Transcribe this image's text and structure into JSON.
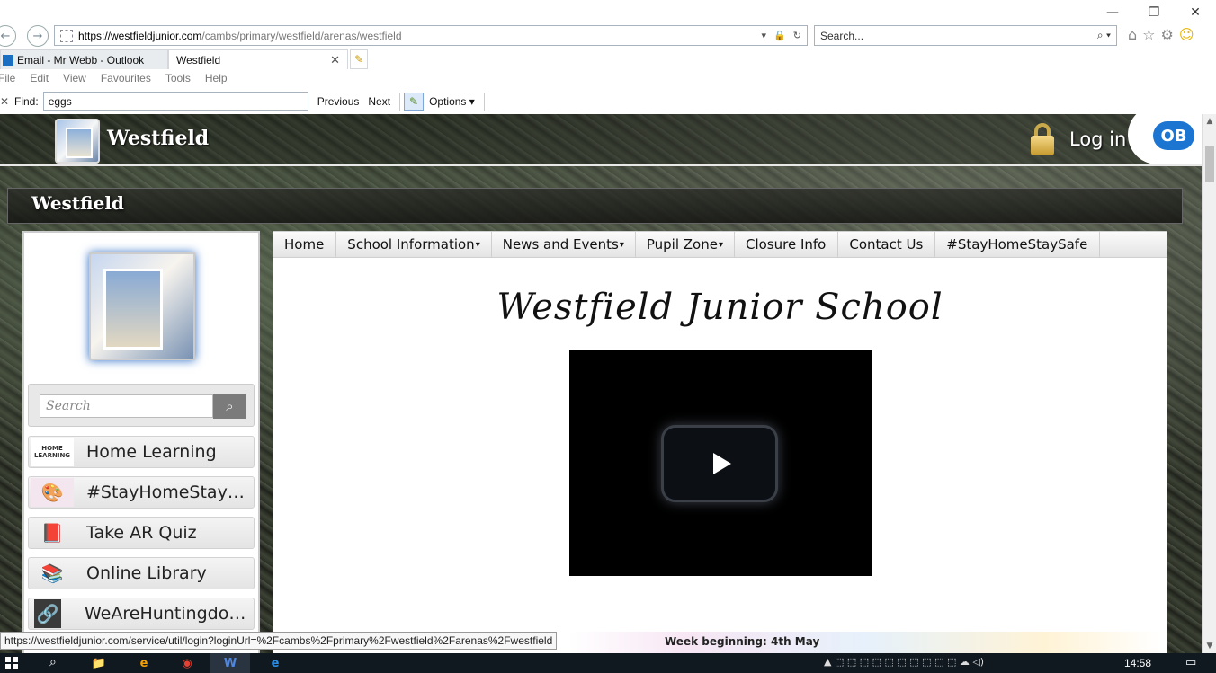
{
  "browser": {
    "window_controls": {
      "minimize": "—",
      "restore": "❐",
      "close": "✕"
    },
    "back_glyph": "←",
    "forward_glyph": "→",
    "address": {
      "host": "https://westfieldjunior.com",
      "path": "/cambs/primary/westfield/arenas/westfield"
    },
    "address_tools": {
      "dropdown": "▾",
      "lock": "🔒",
      "refresh": "↻"
    },
    "search_placeholder": "Search...",
    "search_tools": "⌕ ▾",
    "right_icons": {
      "home": "⌂",
      "favorites": "☆",
      "settings": "⚙",
      "feedback": "☺"
    },
    "tabs": [
      {
        "label": "Email - Mr Webb - Outlook"
      },
      {
        "label": "Westfield",
        "close": "✕"
      }
    ],
    "new_tab_glyph": "✎",
    "menu": [
      "File",
      "Edit",
      "View",
      "Favourites",
      "Tools",
      "Help"
    ],
    "find_bar": {
      "close": "✕",
      "label": "Find:",
      "value": "eggs",
      "previous": "Previous",
      "next": "Next",
      "highlight_glyph": "✎",
      "options": "Options"
    }
  },
  "site": {
    "header": {
      "brand": "Westfield",
      "login": "Log in",
      "badge": "OB"
    },
    "title_bar": "Westfield",
    "sidebar": {
      "search_placeholder": "Search",
      "search_glyph": "⌕",
      "items": [
        {
          "label": "Home Learning",
          "thumb": "HOME LEARNING"
        },
        {
          "label": "#StayHomeStaySafe",
          "thumb": "🎨"
        },
        {
          "label": "Take AR Quiz",
          "thumb": "📕"
        },
        {
          "label": "Online Library",
          "thumb": "📚"
        },
        {
          "label": "WeAreHuntingdons...",
          "thumb": "🔗"
        }
      ]
    },
    "nav": [
      {
        "label": "Home",
        "caret": ""
      },
      {
        "label": "School Information",
        "caret": "▾"
      },
      {
        "label": "News and Events",
        "caret": "▾"
      },
      {
        "label": "Pupil Zone",
        "caret": "▾"
      },
      {
        "label": "Closure Info",
        "caret": ""
      },
      {
        "label": "Contact Us",
        "caret": ""
      },
      {
        "label": "#StayHomeStaySafe",
        "caret": ""
      }
    ],
    "school_title": "Westfield Junior School",
    "banner_text": "Week beginning: 4th May"
  },
  "status_url": "https://westfieldjunior.com/service/util/login?loginUrl=%2Fcambs%2Fprimary%2Fwestfield%2Farenas%2Fwestfield",
  "taskbar": {
    "search_glyph": "⌕",
    "apps": [
      "📁",
      "e",
      "◉",
      "W",
      "e"
    ],
    "tray": "▲ ⬚ ⬚ ⬚ ⬚ ⬚ ⬚ ⬚ ⬚ ⬚ ⬚ ☁ ◁)",
    "clock": "14:58",
    "notify": "▭"
  },
  "colors": {
    "ie_blue": "#1b75d1",
    "accent_gold": "#c69a2e",
    "nav_gray": "#e4e4e4"
  }
}
